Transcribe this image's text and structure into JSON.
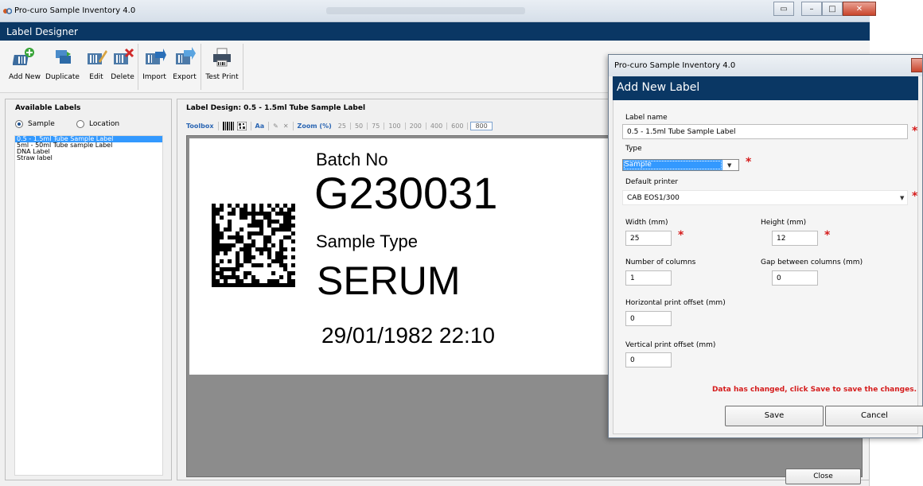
{
  "window": {
    "title": "Pro-curo Sample Inventory 4.0"
  },
  "app_bar": {
    "title": "Label Designer"
  },
  "toolbar": {
    "buttons": [
      {
        "label": "Add New",
        "icon": "add-new-icon"
      },
      {
        "label": "Duplicate",
        "icon": "duplicate-icon"
      },
      {
        "label": "Edit",
        "icon": "edit-icon"
      },
      {
        "label": "Delete",
        "icon": "delete-icon"
      },
      {
        "label": "Import",
        "icon": "import-icon"
      },
      {
        "label": "Export",
        "icon": "export-icon"
      },
      {
        "label": "Test Print",
        "icon": "printer-icon"
      }
    ]
  },
  "available_labels": {
    "heading": "Available Labels",
    "radios": [
      {
        "label": "Sample",
        "checked": true
      },
      {
        "label": "Location",
        "checked": false
      }
    ],
    "items": [
      "0.5 - 1.5ml Tube Sample Label",
      "5ml - 50ml Tube sample Label",
      "DNA Label",
      "Straw label"
    ],
    "selected_index": 0
  },
  "design": {
    "heading": "Label Design: 0.5 - 1.5ml Tube Sample Label",
    "toolbox_label": "Toolbox",
    "font_label": "Aa",
    "zoom_label": "Zoom (%)",
    "zoom_levels": [
      "25",
      "50",
      "75",
      "100",
      "200",
      "400",
      "600",
      "800"
    ],
    "zoom_selected": "800",
    "label_content": {
      "batch_caption": "Batch No",
      "batch_value": "G230031",
      "type_caption": "Sample Type",
      "type_value": "SERUM",
      "datetime": "29/01/1982 22:10"
    }
  },
  "close_button": "Close",
  "dialog": {
    "window_title": "Pro-curo Sample Inventory 4.0",
    "header": "Add New Label",
    "fields": {
      "label_name": {
        "label": "Label name",
        "value": "0.5 - 1.5ml Tube Sample Label"
      },
      "type": {
        "label": "Type",
        "value": "Sample"
      },
      "default_printer": {
        "label": "Default printer",
        "value": "CAB EOS1/300"
      },
      "width": {
        "label": "Width (mm)",
        "value": "25"
      },
      "height": {
        "label": "Height (mm)",
        "value": "12"
      },
      "columns": {
        "label": "Number of columns",
        "value": "1"
      },
      "gap": {
        "label": "Gap between columns (mm)",
        "value": "0"
      },
      "h_offset": {
        "label": "Horizontal print offset (mm)",
        "value": "0"
      },
      "v_offset": {
        "label": "Vertical print offset (mm)",
        "value": "0"
      }
    },
    "required_marker": "*",
    "message": "Data has changed, click Save to save the changes.",
    "save_label": "Save",
    "cancel_label": "Cancel"
  },
  "colors": {
    "accent_bar": "#0a3764",
    "selection": "#3399ff",
    "required": "#d51c1c",
    "link_blue": "#2b66b3"
  }
}
